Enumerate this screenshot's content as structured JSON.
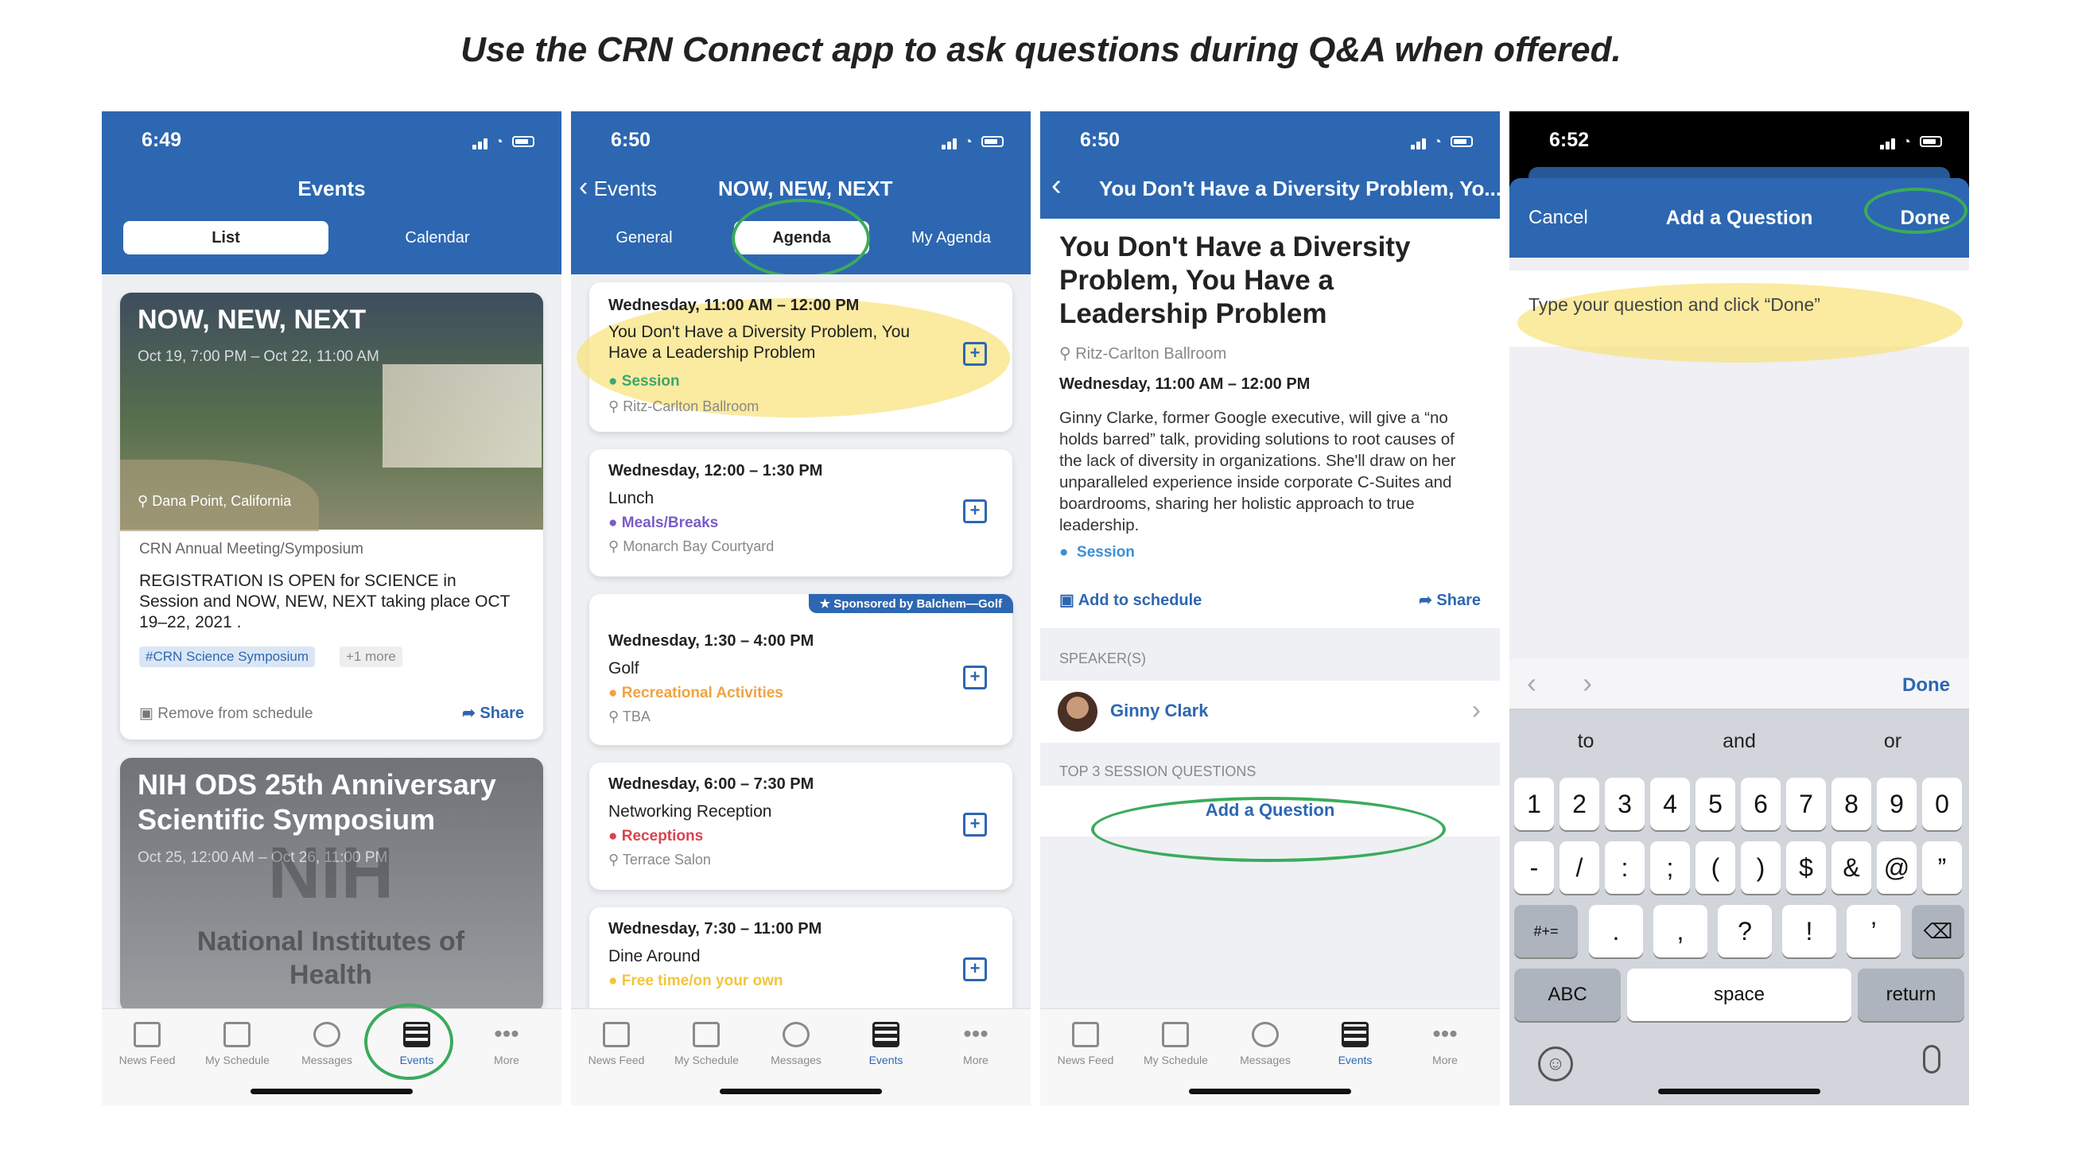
{
  "title": "Use the CRN Connect app to ask questions during Q&A when offered.",
  "p1": {
    "time": "6:49",
    "header": "Events",
    "tab_list": "List",
    "tab_calendar": "Calendar",
    "card1": {
      "title": "NOW, NEW, NEXT",
      "dates": "Oct 19, 7:00 PM – Oct 22, 11:00 AM",
      "location": "Dana Point, California",
      "org": "CRN Annual Meeting/Symposium",
      "desc": "REGISTRATION IS OPEN for SCIENCE in Session and NOW, NEW, NEXT taking place OCT 19–22, 2021 .",
      "tag": "#CRN Science Symposium",
      "more": "+1 more",
      "remove": "Remove from schedule",
      "share": "Share"
    },
    "card2": {
      "title": "NIH ODS 25th Anniversary Scientific Symposium",
      "dates": "Oct 25, 12:00 AM – Oct 26, 11:00 PM",
      "logo": "NIH",
      "logo_text": "National Institutes of Health"
    }
  },
  "tabbar": [
    "News Feed",
    "My Schedule",
    "Messages",
    "Events",
    "More"
  ],
  "p2": {
    "time": "6:50",
    "back": "Events",
    "header": "NOW, NEW, NEXT",
    "tabs": [
      "General",
      "Agenda",
      "My Agenda"
    ],
    "sponsor": "Sponsored by Balchem—Golf",
    "items": [
      {
        "time": "Wednesday, 11:00 AM – 12:00 PM",
        "title": "You Don't Have a Diversity Problem, You Have a Leadership Problem",
        "type": "Session",
        "type_color": "#3aa76d",
        "loc": "Ritz-Carlton Ballroom"
      },
      {
        "time": "Wednesday, 12:00 – 1:30 PM",
        "title": "Lunch",
        "type": "Meals/Breaks",
        "type_color": "#7a5cc4",
        "loc": "Monarch Bay Courtyard"
      },
      {
        "time": "Wednesday, 1:30 – 4:00 PM",
        "title": "Golf",
        "type": "Recreational Activities",
        "type_color": "#f0a342",
        "loc": "TBA"
      },
      {
        "time": "Wednesday, 6:00 – 7:30 PM",
        "title": "Networking Reception",
        "type": "Receptions",
        "type_color": "#d9434e",
        "loc": "Terrace Salon"
      },
      {
        "time": "Wednesday, 7:30 – 11:00 PM",
        "title": "Dine Around",
        "type": "Free time/on your own",
        "type_color": "#f2c53d",
        "loc": ""
      }
    ]
  },
  "p3": {
    "time": "6:50",
    "header": "You Don't Have a Diversity Problem, Yo...",
    "title": "You Don't Have a Diversity Problem, You Have a Leadership Problem",
    "loc": "Ritz-Carlton Ballroom",
    "when": "Wednesday, 11:00 AM – 12:00 PM",
    "desc": "Ginny Clarke, former Google executive, will give a “no holds barred” talk, providing solutions to root causes of the lack of diversity in organizations. She'll draw on her unparalleled experience inside corporate C-Suites and boardrooms, sharing her holistic approach to true leadership.",
    "type": "Session",
    "add": "Add to schedule",
    "share": "Share",
    "speakers": "SPEAKER(S)",
    "speaker": "Ginny Clark",
    "top3": "TOP 3 SESSION QUESTIONS",
    "add_q": "Add a Question"
  },
  "p4": {
    "time": "6:52",
    "cancel": "Cancel",
    "header": "Add a Question",
    "done": "Done",
    "placeholder": "Type your question and click “Done”",
    "done2": "Done",
    "suggest": [
      "to",
      "and",
      "or"
    ],
    "row1": [
      "1",
      "2",
      "3",
      "4",
      "5",
      "6",
      "7",
      "8",
      "9",
      "0"
    ],
    "row2": [
      "-",
      "/",
      ":",
      ";",
      "(",
      ")",
      "$",
      "&",
      "@",
      "”"
    ],
    "row3": [
      ".",
      ",",
      "?",
      "!",
      "’"
    ],
    "sym": "#+=",
    "abc": "ABC",
    "space": "space",
    "ret": "return"
  },
  "colors": {
    "accent": "#2d67b1",
    "highlight": "#fae278",
    "circle": "#3bab5c"
  }
}
